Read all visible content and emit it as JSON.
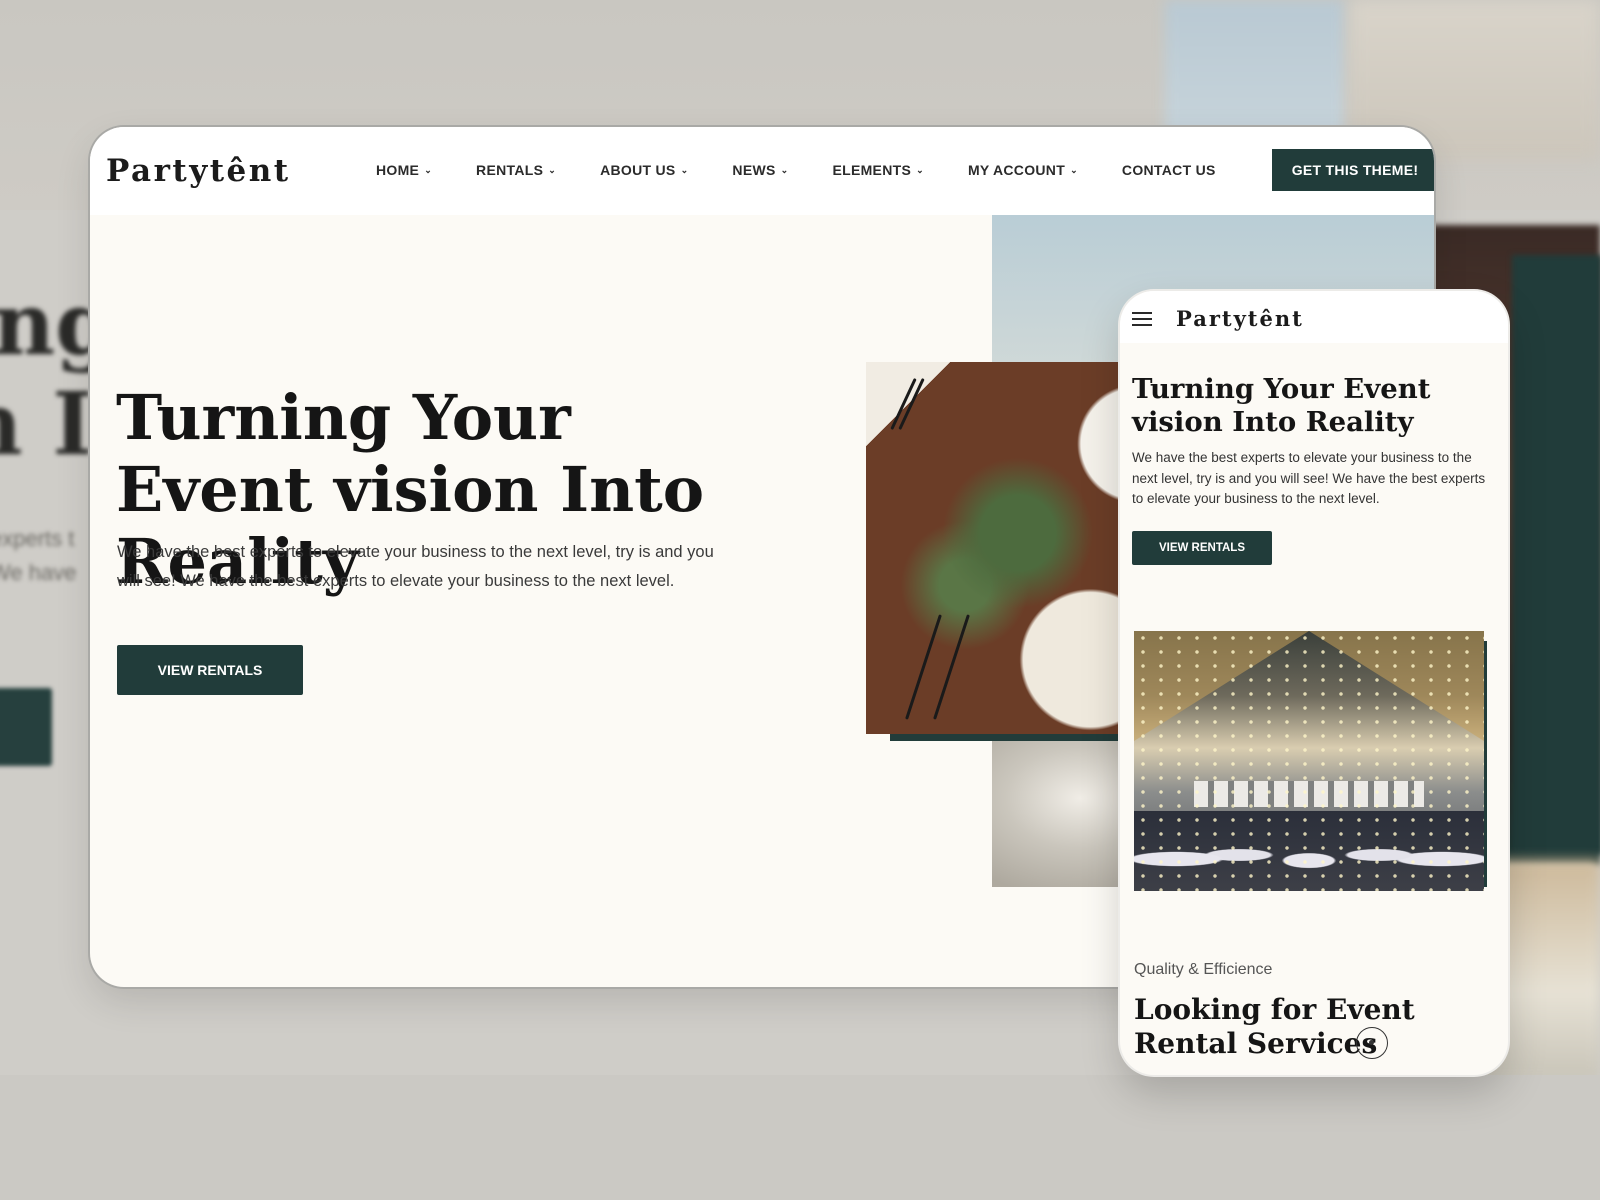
{
  "background": {
    "left_title_fragment": "ing\nn I",
    "left_text_fragment": "experts t\nWe have"
  },
  "desktop": {
    "logo": "Partytênt",
    "nav": [
      {
        "label": "HOME",
        "dropdown": true
      },
      {
        "label": "RENTALS",
        "dropdown": true
      },
      {
        "label": "ABOUT US",
        "dropdown": true
      },
      {
        "label": "NEWS",
        "dropdown": true
      },
      {
        "label": "ELEMENTS",
        "dropdown": true
      },
      {
        "label": "MY ACCOUNT",
        "dropdown": true
      },
      {
        "label": "CONTACT US",
        "dropdown": false
      }
    ],
    "cta_label": "GET THIS THEME!",
    "hero": {
      "title": "Turning Your Event vision Into Reality",
      "text": "We have the best experts to elevate your business to the next level, try is and you will see! We have the best experts to elevate your business to the next level.",
      "button": "VIEW RENTALS"
    }
  },
  "mobile": {
    "logo": "Partytênt",
    "hero": {
      "title": "Turning Your Event vision Into Reality",
      "text": "We have the best experts to elevate your business to the next level, try is and you will see! We have the best experts to elevate your business to the next level.",
      "button": "VIEW RENTALS"
    },
    "section_subtitle": "Quality & Efficience",
    "section_title": "Looking for Event Rental Services"
  },
  "colors": {
    "accent": "#213c3a",
    "page_bg": "#fcfaf5",
    "backdrop": "#cfcdc8",
    "text": "#151515"
  },
  "icons": {
    "chevron": "chevron-down-icon",
    "menu": "hamburger-icon",
    "scroll": "scroll-indicator-icon"
  }
}
